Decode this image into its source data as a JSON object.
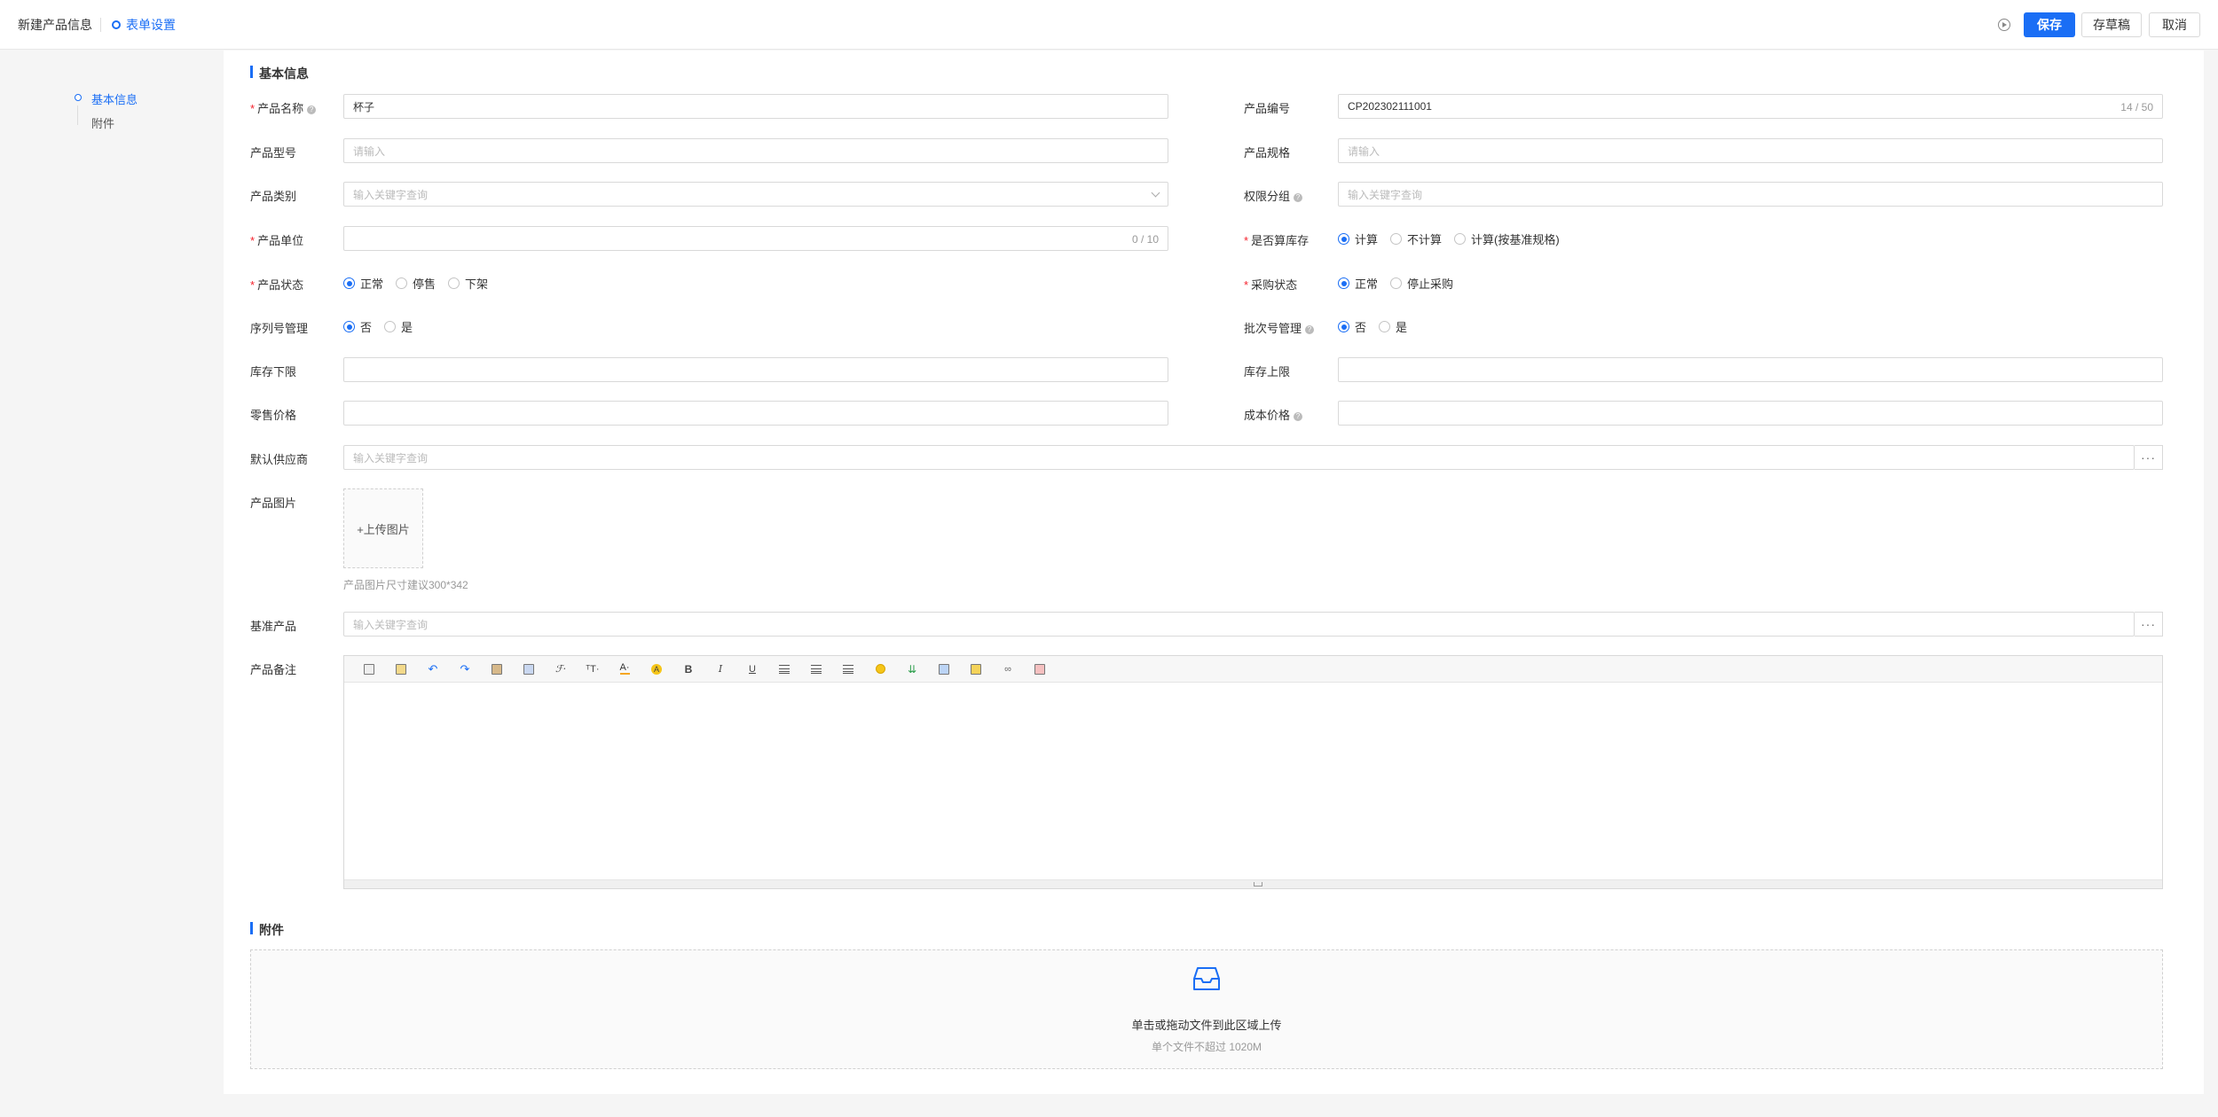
{
  "header": {
    "title": "新建产品信息",
    "form_settings": "表单设置",
    "save": "保存",
    "draft": "存草稿",
    "cancel": "取消"
  },
  "sidenav": {
    "items": [
      {
        "label": "基本信息",
        "active": true
      },
      {
        "label": "附件",
        "active": false
      }
    ]
  },
  "sections": {
    "basic": "基本信息",
    "attachment": "附件"
  },
  "fields": {
    "product_name": {
      "label": "产品名称",
      "value": "杯子"
    },
    "product_code": {
      "label": "产品编号",
      "value": "CP202302111001",
      "count": "14 / 50"
    },
    "product_model": {
      "label": "产品型号",
      "placeholder": "请输入"
    },
    "product_spec": {
      "label": "产品规格",
      "placeholder": "请输入"
    },
    "product_category": {
      "label": "产品类别",
      "placeholder": "输入关键字查询"
    },
    "permission_group": {
      "label": "权限分组",
      "placeholder": "输入关键字查询"
    },
    "product_unit": {
      "label": "产品单位",
      "count": "0 / 10"
    },
    "count_stock": {
      "label": "是否算库存",
      "options": [
        "计算",
        "不计算",
        "计算(按基准规格)"
      ],
      "selected": "计算"
    },
    "product_status": {
      "label": "产品状态",
      "options": [
        "正常",
        "停售",
        "下架"
      ],
      "selected": "正常"
    },
    "purchase_status": {
      "label": "采购状态",
      "options": [
        "正常",
        "停止采购"
      ],
      "selected": "正常"
    },
    "serial_mgmt": {
      "label": "序列号管理",
      "options": [
        "否",
        "是"
      ],
      "selected": "否"
    },
    "batch_mgmt": {
      "label": "批次号管理",
      "options": [
        "否",
        "是"
      ],
      "selected": "否"
    },
    "stock_min": {
      "label": "库存下限"
    },
    "stock_max": {
      "label": "库存上限"
    },
    "retail_price": {
      "label": "零售价格"
    },
    "cost_price": {
      "label": "成本价格"
    },
    "default_supplier": {
      "label": "默认供应商",
      "placeholder": "输入关键字查询"
    },
    "product_image": {
      "label": "产品图片",
      "upload": "+上传图片",
      "hint": "产品图片尺寸建议300*342"
    },
    "base_product": {
      "label": "基准产品",
      "placeholder": "输入关键字查询"
    },
    "remark": {
      "label": "产品备注"
    }
  },
  "attachment": {
    "primary": "单击或拖动文件到此区域上传",
    "secondary": "单个文件不超过 1020M"
  },
  "toolbar_icons": [
    "source-icon",
    "template-icon",
    "undo-icon",
    "redo-icon",
    "paste-icon",
    "paste-text-icon",
    "font-family-icon",
    "font-size-icon",
    "font-color-icon",
    "highlight-color-icon",
    "bold-icon",
    "italic-icon",
    "underline-icon",
    "align-left-icon",
    "align-center-icon",
    "align-right-icon",
    "emoji-icon",
    "insert-row-icon",
    "image-icon",
    "table-icon",
    "link-icon",
    "special-char-icon"
  ],
  "colors": {
    "primary": "#1a6ef5",
    "required": "#f5222d"
  }
}
